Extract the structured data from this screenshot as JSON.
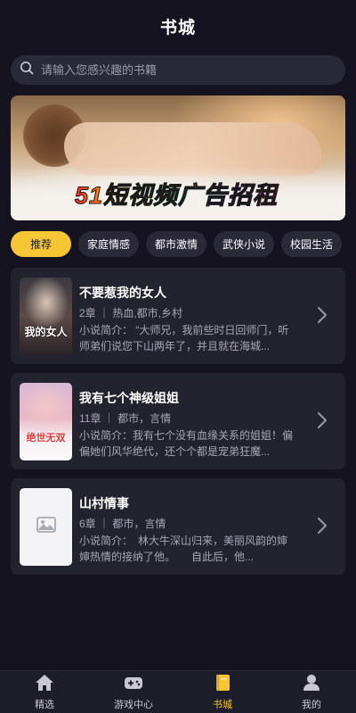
{
  "header": {
    "title": "书城"
  },
  "search": {
    "placeholder": "请输入您感兴趣的书籍"
  },
  "banner": {
    "ad_text": "51短视频广告招租"
  },
  "categories": [
    {
      "label": "推荐",
      "active": true
    },
    {
      "label": "家庭情感",
      "active": false
    },
    {
      "label": "都市激情",
      "active": false
    },
    {
      "label": "武侠小说",
      "active": false
    },
    {
      "label": "校园生活",
      "active": false
    }
  ],
  "books": [
    {
      "title": "不要惹我的女人",
      "meta": "2章 ｜ 热血,都市,乡村",
      "desc": "小说简介： “大师兄，我前些时日回师门，听师弟们说您下山两年了，并且就在海城...",
      "cover_text": "我的女人"
    },
    {
      "title": "我有七个神级姐姐",
      "meta": "11章 ｜ 都市，言情",
      "desc": "小说简介：我有七个没有血缘关系的姐姐！偏偏她们风华绝代，还个个都是宠弟狂魔...",
      "cover_text": "绝世无双"
    },
    {
      "title": "山村情事",
      "meta": "6章 ｜ 都市，言情",
      "desc": "小说简介：　林大牛深山归来，美丽风韵的婶婶热情的接纳了他。　　自此后，他...",
      "cover_text": ""
    }
  ],
  "tabbar": [
    {
      "label": "精选",
      "icon": "home-icon",
      "active": false
    },
    {
      "label": "游戏中心",
      "icon": "gamepad-icon",
      "active": false
    },
    {
      "label": "书城",
      "icon": "book-icon",
      "active": true
    },
    {
      "label": "我的",
      "icon": "user-icon",
      "active": false
    }
  ],
  "colors": {
    "accent": "#f7c634",
    "background": "#14131f",
    "card": "#23222f"
  }
}
